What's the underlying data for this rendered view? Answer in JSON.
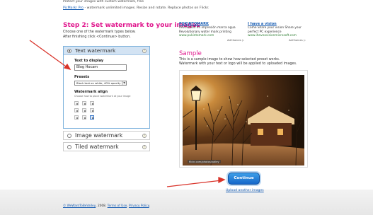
{
  "header": {
    "tagline": "Protect your images with custom watermark, free",
    "promo_link": "PicMarkr Pro",
    "promo_text": " - watermark unlimited images. Resize and rotate. Replace photos on Flickr."
  },
  "step": {
    "title": "Step 2: Set watermark to your images",
    "line1": "Choose one of the watermark types below.",
    "line2": "After finishing click <Continue> button."
  },
  "text_watermark": {
    "title": "Text watermark",
    "text_label": "Text to display",
    "text_value": "Blog Hocam",
    "presets_label": "Presets",
    "preset_value": "Black text on white, 40% opacity",
    "align_label": "Watermark align",
    "align_hint": "Choose how to place watermark at your image",
    "help_glyph": "?"
  },
  "options": {
    "image_watermark": "Image watermark",
    "tiled_watermark": "Tiled watermark"
  },
  "ads": [
    {
      "title": "PUKINTOMARK",
      "line1": "Revolución en impresión marca agua",
      "line2": "Revolutionary water mark printing",
      "url": "www.pukintomark.com"
    },
    {
      "title": "I have a vision",
      "line1": "Come Share your vision Share your",
      "line2": "perfect PC experience",
      "url": "www.ihaveavisionmicrosoft.com"
    }
  ],
  "adchoices": "AdChoices ▷",
  "sample": {
    "title": "Sample",
    "line1": "This is a sample image to show how selected preset works.",
    "line2": "Watermark with your text or logo will be applied to uploaded images.",
    "credit": "flickr.com/photos/valley"
  },
  "actions": {
    "continue": "Continue",
    "upload_another": "Upload another images"
  },
  "footer": {
    "copyright_link": "© WeWantToBeValley",
    "text": ", 2008. ",
    "terms": "Terms of Use",
    "sep": ", ",
    "privacy": "Privacy Policy",
    "end": "."
  },
  "colors": {
    "accent_pink": "#e0178d",
    "link_blue": "#1a5fb4",
    "button_blue": "#1566c9",
    "arrow_red": "#d9342b"
  }
}
